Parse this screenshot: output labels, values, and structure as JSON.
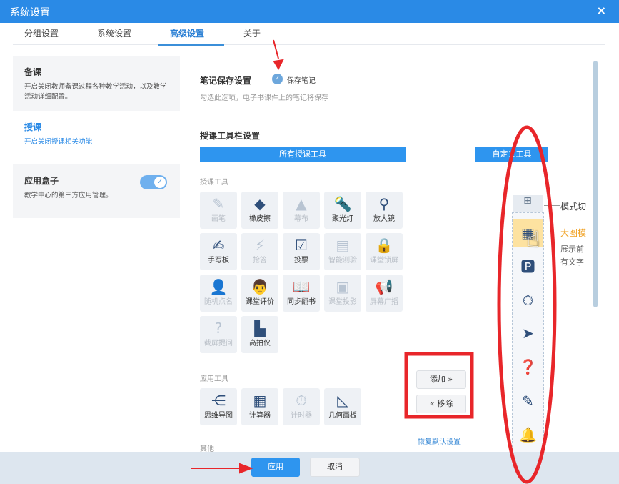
{
  "window": {
    "title": "系统设置",
    "close": "×"
  },
  "tabs": [
    {
      "label": "分组设置"
    },
    {
      "label": "系统设置"
    },
    {
      "label": "高级设置",
      "active": true
    },
    {
      "label": "关于"
    }
  ],
  "left": [
    {
      "title": "备课",
      "desc": "开启关闭教师备课过程各种教学活动，以及教学活动详细配置。"
    },
    {
      "title": "授课",
      "desc": "开启关闭授课相关功能"
    },
    {
      "title": "应用盒子",
      "desc": "教学中心的第三方应用管理。",
      "toggle": true
    }
  ],
  "notes": {
    "title": "笔记保存设置",
    "checkbox_label": "保存笔记",
    "checked": true,
    "desc": "勾选此选项，电子书课件上的笔记将保存"
  },
  "toolbar": {
    "title": "授课工具栏设置",
    "all_tools": "所有授课工具",
    "custom_tools": "自定义工具"
  },
  "teaching_tools": {
    "label": "授课工具",
    "items": [
      {
        "label": "画笔",
        "icon": "pen-icon",
        "enabled": false
      },
      {
        "label": "橡皮擦",
        "icon": "eraser-icon",
        "enabled": true
      },
      {
        "label": "幕布",
        "icon": "curtain-icon",
        "enabled": false
      },
      {
        "label": "聚光灯",
        "icon": "spotlight-icon",
        "enabled": true
      },
      {
        "label": "放大镜",
        "icon": "magnifier-icon",
        "enabled": true
      },
      {
        "label": "手写板",
        "icon": "handwriting-icon",
        "enabled": true
      },
      {
        "label": "抢答",
        "icon": "buzzer-icon",
        "enabled": false
      },
      {
        "label": "投票",
        "icon": "vote-icon",
        "enabled": true
      },
      {
        "label": "智能测验",
        "icon": "quiz-icon",
        "enabled": false
      },
      {
        "label": "课堂锁屏",
        "icon": "lock-icon",
        "enabled": false
      },
      {
        "label": "随机点名",
        "icon": "random-call-icon",
        "enabled": false
      },
      {
        "label": "课堂评价",
        "icon": "evaluation-icon",
        "enabled": true
      },
      {
        "label": "同步翻书",
        "icon": "book-icon",
        "enabled": true
      },
      {
        "label": "课堂投影",
        "icon": "projector-icon",
        "enabled": false
      },
      {
        "label": "屏幕广播",
        "icon": "broadcast-icon",
        "enabled": false
      },
      {
        "label": "截屏提问",
        "icon": "screenshot-question-icon",
        "enabled": false
      },
      {
        "label": "高拍仪",
        "icon": "document-camera-icon",
        "enabled": true
      }
    ]
  },
  "app_tools": {
    "label": "应用工具",
    "items": [
      {
        "label": "思维导图",
        "icon": "mindmap-icon",
        "enabled": true
      },
      {
        "label": "计算器",
        "icon": "calculator-icon",
        "enabled": true
      },
      {
        "label": "计时器",
        "icon": "timer-icon",
        "enabled": false
      },
      {
        "label": "几何画板",
        "icon": "geometry-icon",
        "enabled": true
      }
    ]
  },
  "other_label": "其他",
  "add_button": "添加 »",
  "remove_button": "« 移除",
  "restore_link": "恢复默认设置",
  "custom_toolbar": {
    "labels": [
      "模式切",
      "大图模",
      "展示前",
      "有文字"
    ]
  },
  "footer": {
    "apply": "应用",
    "cancel": "取消"
  }
}
